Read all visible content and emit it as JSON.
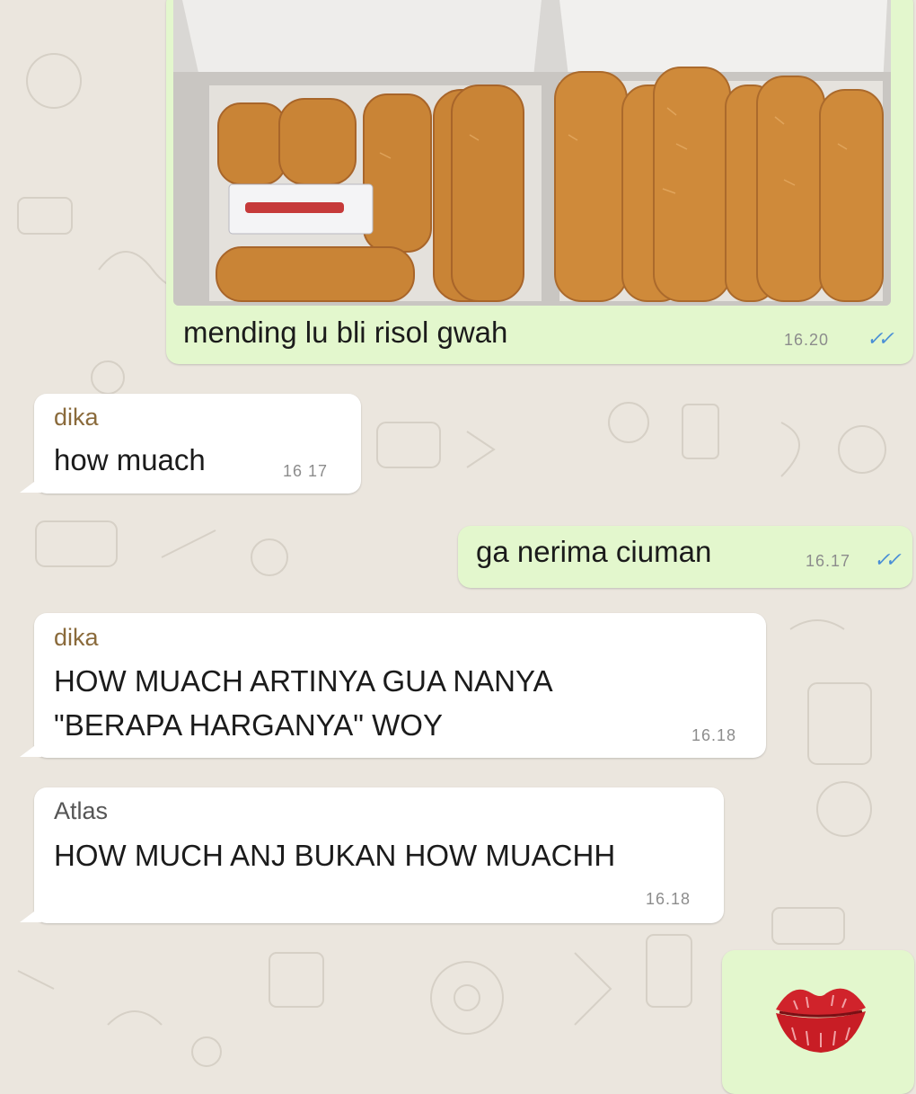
{
  "messages": [
    {
      "id": "m1",
      "direction": "outgoing",
      "type": "image",
      "caption": "mending lu bli risol gwah",
      "time": "16.20",
      "status": "read",
      "image_icon": "risol-box-photo"
    },
    {
      "id": "m2",
      "direction": "incoming",
      "sender": "dika",
      "text": "how muach",
      "time": "16 17"
    },
    {
      "id": "m3",
      "direction": "outgoing",
      "text": "ga nerima ciuman",
      "time": "16.17",
      "status": "read"
    },
    {
      "id": "m4",
      "direction": "incoming",
      "sender": "dika",
      "lines": [
        "HOW MUACH ARTINYA GUA NANYA",
        "\"BERAPA HARGANYA\" WOY"
      ],
      "time": "16.18"
    },
    {
      "id": "m5",
      "direction": "incoming",
      "sender": "Atlas",
      "text": "HOW MUCH ANJ BUKAN HOW MUACHH",
      "time": "16.18"
    },
    {
      "id": "m6",
      "direction": "outgoing",
      "type": "sticker",
      "icon": "kiss-lips-icon"
    }
  ],
  "colors": {
    "outgoing_bubble": "#e3f7cd",
    "incoming_bubble": "#ffffff",
    "chat_background": "#ebe6de",
    "read_ticks": "#4a8fd6",
    "sender_dika": "#8a6a3b",
    "lips": "#d0232b"
  }
}
